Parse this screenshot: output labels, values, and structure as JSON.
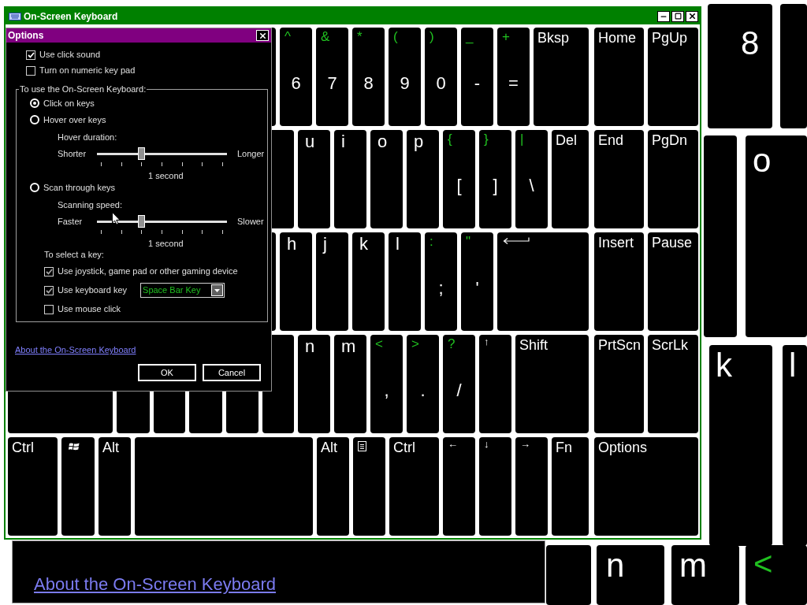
{
  "background_view": {
    "keys": [
      {
        "kind": "letter",
        "label": "8"
      },
      {
        "kind": "letter",
        "label": "o"
      },
      {
        "kind": "letter",
        "label": "k"
      },
      {
        "kind": "letter",
        "label": "l"
      },
      {
        "kind": "letter",
        "label": "n"
      },
      {
        "kind": "letter",
        "label": "m"
      },
      {
        "kind": "symbol",
        "label": "<"
      }
    ],
    "link": "About the On-Screen Keyboard"
  },
  "keyboard_window": {
    "title": "On-Screen Keyboard",
    "rows": [
      {
        "main": [
          {
            "kind": "blank"
          },
          {
            "kind": "dual",
            "shift": "^",
            "label": "6"
          },
          {
            "kind": "dual",
            "shift": "&",
            "label": "7"
          },
          {
            "kind": "dual",
            "shift": "*",
            "label": "8"
          },
          {
            "kind": "dual",
            "shift": "(",
            "label": "9"
          },
          {
            "kind": "dual",
            "shift": ")",
            "label": "0"
          },
          {
            "kind": "dual",
            "shift": "_",
            "label": "-"
          },
          {
            "kind": "dual",
            "shift": "+",
            "label": "="
          },
          {
            "kind": "named",
            "label": "Bksp"
          }
        ],
        "nav": [
          {
            "kind": "named",
            "label": "Home"
          },
          {
            "kind": "named",
            "label": "PgUp"
          }
        ]
      },
      {
        "main": [
          {
            "kind": "blank"
          },
          {
            "kind": "letter",
            "label": "u"
          },
          {
            "kind": "letter",
            "label": "i"
          },
          {
            "kind": "letter",
            "label": "o"
          },
          {
            "kind": "letter",
            "label": "p"
          },
          {
            "kind": "dual",
            "shift": "{",
            "label": "["
          },
          {
            "kind": "dual",
            "shift": "}",
            "label": "]"
          },
          {
            "kind": "dual",
            "shift": "|",
            "label": "\\"
          },
          {
            "kind": "named",
            "label": "Del"
          }
        ],
        "nav": [
          {
            "kind": "named",
            "label": "End"
          },
          {
            "kind": "named",
            "label": "PgDn"
          }
        ]
      },
      {
        "main": [
          {
            "kind": "blank"
          },
          {
            "kind": "letter",
            "label": "h"
          },
          {
            "kind": "letter",
            "label": "j"
          },
          {
            "kind": "letter",
            "label": "k"
          },
          {
            "kind": "letter",
            "label": "l"
          },
          {
            "kind": "dual",
            "shift": ":",
            "label": ";"
          },
          {
            "kind": "dual",
            "shift": "\"",
            "label": "'"
          },
          {
            "kind": "enter"
          }
        ],
        "nav": [
          {
            "kind": "named",
            "label": "Insert"
          },
          {
            "kind": "named",
            "label": "Pause"
          }
        ]
      },
      {
        "main": [
          {
            "kind": "blank"
          },
          {
            "kind": "blank"
          },
          {
            "kind": "blank"
          },
          {
            "kind": "blank"
          },
          {
            "kind": "blank"
          },
          {
            "kind": "blank"
          },
          {
            "kind": "letter",
            "label": "n"
          },
          {
            "kind": "letter",
            "label": "m"
          },
          {
            "kind": "dual",
            "shift": "<",
            "label": ","
          },
          {
            "kind": "dual",
            "shift": ">",
            "label": "."
          },
          {
            "kind": "dual",
            "shift": "?",
            "label": "/"
          },
          {
            "kind": "arrow",
            "label": "↑"
          },
          {
            "kind": "named",
            "label": "Shift"
          }
        ],
        "nav": [
          {
            "kind": "named",
            "label": "PrtScn"
          },
          {
            "kind": "named",
            "label": "ScrLk"
          }
        ]
      },
      {
        "main": [
          {
            "kind": "named",
            "label": "Ctrl"
          },
          {
            "kind": "windows"
          },
          {
            "kind": "named",
            "label": "Alt"
          },
          {
            "kind": "blank"
          },
          {
            "kind": "named",
            "label": "Alt"
          },
          {
            "kind": "menu"
          },
          {
            "kind": "named",
            "label": "Ctrl"
          },
          {
            "kind": "arrow",
            "label": "←"
          },
          {
            "kind": "arrow",
            "label": "↓"
          },
          {
            "kind": "arrow",
            "label": "→"
          },
          {
            "kind": "named",
            "label": "Fn"
          }
        ],
        "nav": [
          {
            "kind": "named",
            "label": "Options"
          }
        ]
      }
    ]
  },
  "options_dialog": {
    "title": "Options",
    "checkboxes": [
      {
        "label": "Use click sound",
        "checked": true
      },
      {
        "label": "Turn on numeric key pad",
        "checked": false
      }
    ],
    "mode_group": {
      "title": "To use the On-Screen Keyboard:",
      "modes": [
        {
          "label": "Click on keys",
          "selected": true
        },
        {
          "label": "Hover over keys",
          "selected": false,
          "setting": {
            "label": "Hover duration:",
            "min_label": "Shorter",
            "max_label": "Longer",
            "level": 0.33,
            "reading": "1 second"
          }
        },
        {
          "label": "Scan through keys",
          "selected": false,
          "setting": {
            "label": "Scanning speed:",
            "min_label": "Faster",
            "max_label": "Slower",
            "level": 0.33,
            "reading": "1 second"
          }
        }
      ],
      "select_key": {
        "label": "To select a key:",
        "options": [
          {
            "label": "Use joystick, game pad or other gaming device",
            "checked": true
          },
          {
            "label": "Use keyboard key",
            "checked": true,
            "dropdown": "Space Bar Key"
          },
          {
            "label": "Use mouse click",
            "checked": false
          }
        ]
      }
    },
    "link": "About the On-Screen Keyboard",
    "buttons": [
      "OK",
      "Cancel"
    ]
  }
}
